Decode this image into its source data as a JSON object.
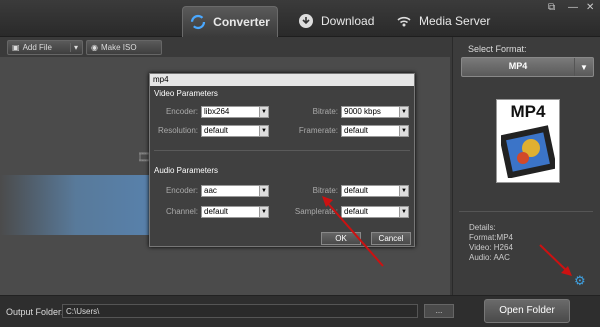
{
  "tabs": [
    {
      "label": "Converter",
      "icon": "refresh-icon",
      "active": true
    },
    {
      "label": "Download",
      "icon": "download-icon",
      "active": false
    },
    {
      "label": "Media Server",
      "icon": "wifi-icon",
      "active": false
    }
  ],
  "toolbar": {
    "add_file": "Add File",
    "make_iso": "Make ISO"
  },
  "format": {
    "label": "Select Format:",
    "value": "MP4",
    "icon_text": "MP4"
  },
  "details": {
    "title": "Details:",
    "format": "Format:MP4",
    "video": "Video: H264",
    "audio": "Audio: AAC"
  },
  "output": {
    "label": "Output Folder:",
    "path": "C:\\Users\\",
    "browse": "...",
    "open_button": "Open Folder"
  },
  "dialog": {
    "title": "mp4",
    "video_section": "Video Parameters",
    "video": {
      "encoder_label": "Encoder:",
      "encoder": "libx264",
      "bitrate_label": "Bitrate:",
      "bitrate": "9000 kbps",
      "resolution_label": "Resolution:",
      "resolution": "default",
      "framerate_label": "Framerate:",
      "framerate": "default"
    },
    "audio_section": "Audio Parameters",
    "audio": {
      "encoder_label": "Encoder:",
      "encoder": "aac",
      "bitrate_label": "Bitrate:",
      "bitrate": "default",
      "channel_label": "Channel:",
      "channel": "default",
      "samplerate_label": "Samplerate:",
      "samplerate": "default"
    },
    "ok": "OK",
    "cancel": "Cancel"
  },
  "colors": {
    "accent": "#3fa0e0",
    "arrow": "#cc1111"
  }
}
